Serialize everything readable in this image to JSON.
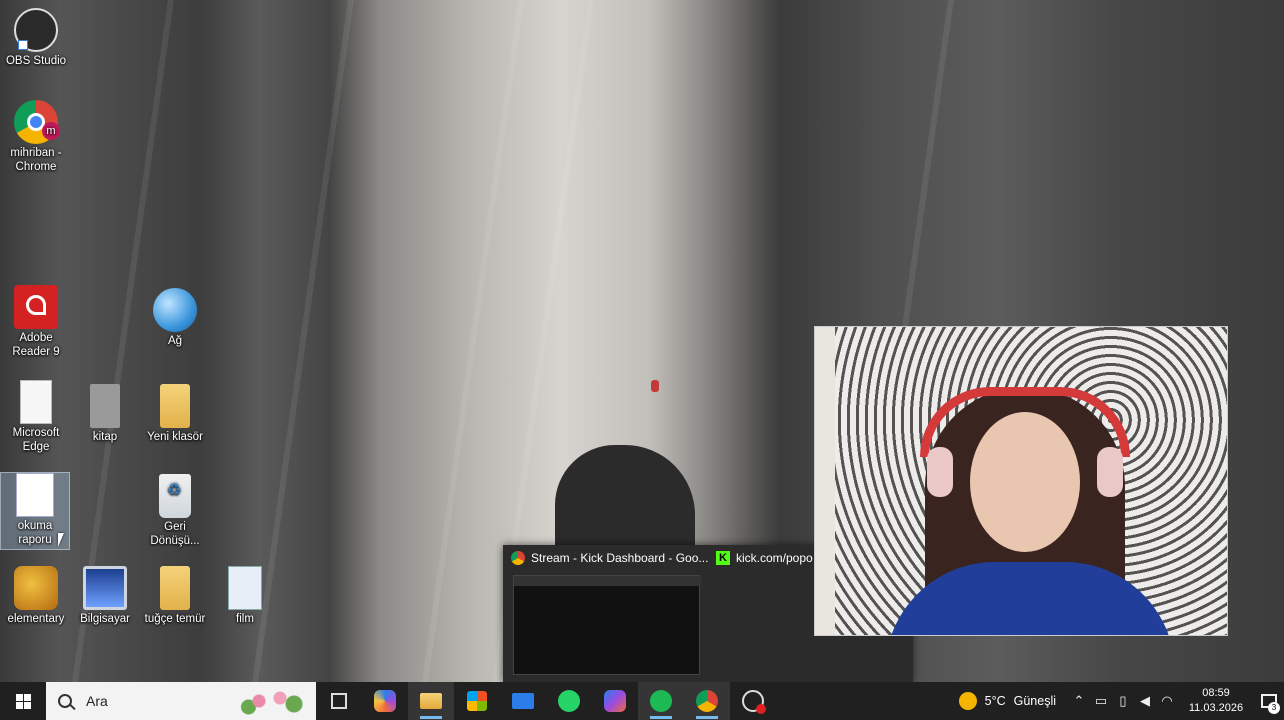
{
  "desktop": {
    "icons": [
      {
        "label": "OBS Studio"
      },
      {
        "label": "mihriban - Chrome",
        "badge": "m"
      },
      {
        "label": "Adobe Reader 9"
      },
      {
        "label": "Ağ"
      },
      {
        "label": "Microsoft Edge"
      },
      {
        "label": "kitap"
      },
      {
        "label": "Yeni klasör"
      },
      {
        "label": "okuma raporu"
      },
      {
        "label": "Geri Dönüşü..."
      },
      {
        "label": "elementary"
      },
      {
        "label": "Bilgisayar"
      },
      {
        "label": "tuğçe temür"
      },
      {
        "label": "film"
      }
    ]
  },
  "preview": {
    "items": [
      {
        "title": "Stream - Kick Dashboard - Goo..."
      },
      {
        "title": "kick.com/popo",
        "kick_letter": "K"
      }
    ]
  },
  "taskbar": {
    "search_placeholder": "Ara",
    "apps": [
      "task-view",
      "copilot",
      "file-explorer",
      "microsoft-store",
      "mail",
      "whatsapp",
      "microsoft-365",
      "spotify",
      "chrome",
      "obs-studio"
    ],
    "m365_label": "M365",
    "weather": {
      "temp": "5°C",
      "condition": "Güneşli"
    },
    "clock": {
      "time": "08:59",
      "date": "11.03.2026"
    },
    "notification_count": "3"
  },
  "colors": {
    "taskbar": "#202020",
    "kick_green": "#53fc18",
    "accent": "#76b9ed"
  }
}
